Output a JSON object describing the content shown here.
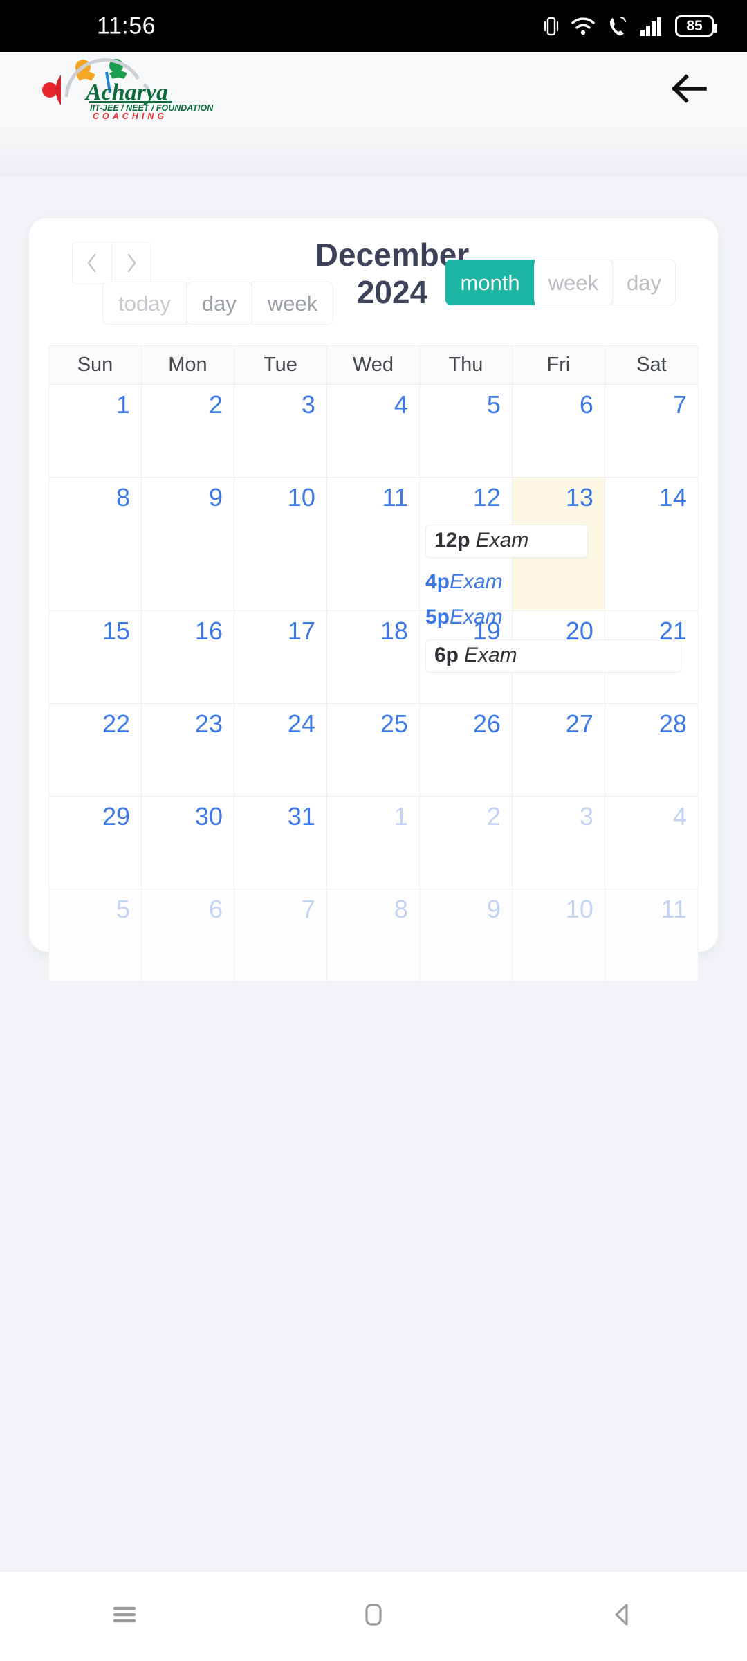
{
  "status_bar": {
    "time": "11:56",
    "battery_percent": "85",
    "icons": [
      "vibrate-icon",
      "wifi-icon",
      "call-icon",
      "signal-icon",
      "battery-icon"
    ]
  },
  "header": {
    "logo_name": "Acharya",
    "logo_tagline": "IIT-JEE / NEET / FOUNDATION",
    "logo_subtitle": "COACHING",
    "back_icon": "arrow-left-icon"
  },
  "calendar": {
    "title": "December 2024",
    "title_line1": "December",
    "title_line2": "2024",
    "prev_label": "‹",
    "next_label": "›",
    "today_label": "today",
    "day_label": "day",
    "week_label": "week",
    "views": [
      {
        "label": "month",
        "active": true
      },
      {
        "label": "week",
        "active": false
      },
      {
        "label": "day",
        "active": false
      }
    ],
    "weekday_headers": [
      "Sun",
      "Mon",
      "Tue",
      "Wed",
      "Thu",
      "Fri",
      "Sat"
    ],
    "weeks": [
      {
        "days": [
          {
            "n": "1",
            "other": false
          },
          {
            "n": "2",
            "other": false
          },
          {
            "n": "3",
            "other": false
          },
          {
            "n": "4",
            "other": false
          },
          {
            "n": "5",
            "other": false
          },
          {
            "n": "6",
            "other": false
          },
          {
            "n": "7",
            "other": false
          }
        ]
      },
      {
        "days": [
          {
            "n": "8",
            "other": false
          },
          {
            "n": "9",
            "other": false
          },
          {
            "n": "10",
            "other": false
          },
          {
            "n": "11",
            "other": false
          },
          {
            "n": "12",
            "other": false
          },
          {
            "n": "13",
            "other": false,
            "today": true
          },
          {
            "n": "14",
            "other": false
          }
        ]
      },
      {
        "days": [
          {
            "n": "15",
            "other": false
          },
          {
            "n": "16",
            "other": false
          },
          {
            "n": "17",
            "other": false
          },
          {
            "n": "18",
            "other": false
          },
          {
            "n": "19",
            "other": false
          },
          {
            "n": "20",
            "other": false
          },
          {
            "n": "21",
            "other": false
          }
        ]
      },
      {
        "days": [
          {
            "n": "22",
            "other": false
          },
          {
            "n": "23",
            "other": false
          },
          {
            "n": "24",
            "other": false
          },
          {
            "n": "25",
            "other": false
          },
          {
            "n": "26",
            "other": false
          },
          {
            "n": "27",
            "other": false
          },
          {
            "n": "28",
            "other": false
          }
        ]
      },
      {
        "days": [
          {
            "n": "29",
            "other": false
          },
          {
            "n": "30",
            "other": false
          },
          {
            "n": "31",
            "other": false
          },
          {
            "n": "1",
            "other": true
          },
          {
            "n": "2",
            "other": true
          },
          {
            "n": "3",
            "other": true
          },
          {
            "n": "4",
            "other": true
          }
        ]
      },
      {
        "days": [
          {
            "n": "5",
            "other": true
          },
          {
            "n": "6",
            "other": true
          },
          {
            "n": "7",
            "other": true
          },
          {
            "n": "8",
            "other": true
          },
          {
            "n": "9",
            "other": true
          },
          {
            "n": "10",
            "other": true
          },
          {
            "n": "11",
            "other": true
          }
        ]
      }
    ],
    "events": [
      {
        "time": "12p",
        "title": "Exam",
        "style": "boxed",
        "day": "12"
      },
      {
        "time": "4p",
        "title": "Exam",
        "style": "plain",
        "day": "12"
      },
      {
        "time": "5p",
        "title": "Exam",
        "style": "plain",
        "day": "12"
      },
      {
        "time": "6p",
        "title": "Exam",
        "style": "boxed",
        "day": "12"
      }
    ]
  },
  "system_nav": {
    "recents_icon": "menu-icon",
    "home_icon": "home-square-icon",
    "back_icon": "back-triangle-icon"
  }
}
